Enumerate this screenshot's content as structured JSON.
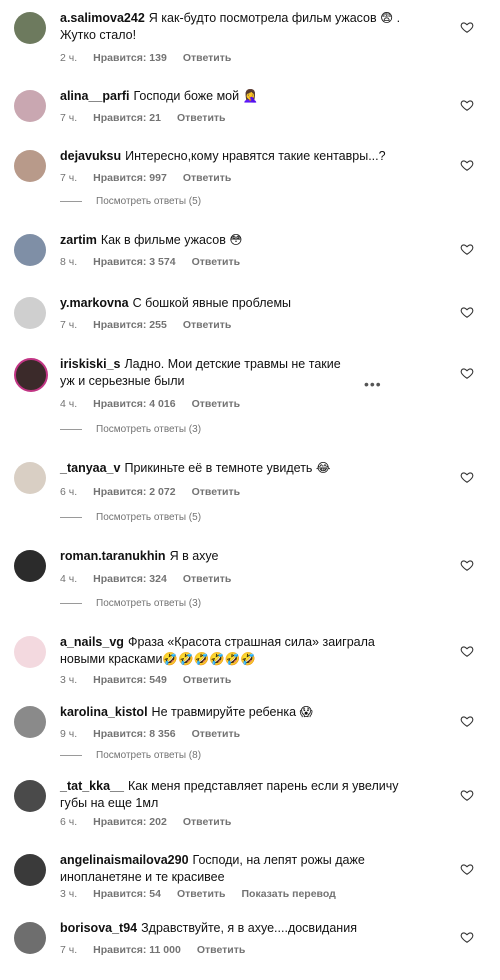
{
  "comments": [
    {
      "user": "a.salimova242",
      "text": "Я как-будто посмотрела фильм ужасов 😨 . Жутко стало!",
      "time": "2 ч.",
      "likes": "Нравится: 139",
      "reply": "Ответить",
      "avatar_color": "#6d7a5e"
    },
    {
      "user": "alina__parfi",
      "text": "Господи боже мой 🤦‍♀️",
      "time": "7 ч.",
      "likes": "Нравится: 21",
      "reply": "Ответить",
      "avatar_color": "#c9a7b1"
    },
    {
      "user": "dejavuksu",
      "text": "Интересно,кому нравятся такие кентавры...?",
      "time": "7 ч.",
      "likes": "Нравится: 997",
      "reply": "Ответить",
      "replies": "Посмотреть ответы (5)",
      "avatar_color": "#b89a8a"
    },
    {
      "user": "zartim",
      "text": "Как в фильме ужасов 😳",
      "time": "8 ч.",
      "likes": "Нравится: 3 574",
      "reply": "Ответить",
      "avatar_color": "#7f8fa6"
    },
    {
      "user": "y.markovna",
      "text": "С бошкой явные проблемы",
      "time": "7 ч.",
      "likes": "Нравится: 255",
      "reply": "Ответить",
      "avatar_color": "#cfcfcf"
    },
    {
      "user": "iriskiski_s",
      "text": "Ладно. Мои детские травмы не такие уж и серьезные были",
      "time": "4 ч.",
      "likes": "Нравится: 4 016",
      "reply": "Ответить",
      "replies": "Посмотреть ответы (3)",
      "avatar_color": "#3b2a2a"
    },
    {
      "user": "_tanyaa_v",
      "text": "Прикиньте её в темноте увидеть 😂",
      "time": "6 ч.",
      "likes": "Нравится: 2 072",
      "reply": "Ответить",
      "replies": "Посмотреть ответы (5)",
      "avatar_color": "#d9cfc4"
    },
    {
      "user": "roman.taranukhin",
      "text": "Я в ахуе",
      "time": "4 ч.",
      "likes": "Нравится: 324",
      "reply": "Ответить",
      "replies": "Посмотреть ответы (3)",
      "avatar_color": "#2b2b2b"
    },
    {
      "user": "a_nails_vg",
      "text": "Фраза «Красота страшная сила» заиграла новыми красками🤣🤣🤣🤣🤣🤣",
      "time": "3 ч.",
      "likes": "Нравится: 549",
      "reply": "Ответить",
      "avatar_color": "#f3d9df"
    },
    {
      "user": "karolina_kistol",
      "text": "Не травмируйте ребенка 😱",
      "time": "9 ч.",
      "likes": "Нравится: 8 356",
      "reply": "Ответить",
      "replies": "Посмотреть ответы (8)",
      "avatar_color": "#8a8a8a"
    },
    {
      "user": "_tat_kka__",
      "text": "Как меня представляет парень если я увеличу губы на еще 1мл",
      "time": "6 ч.",
      "likes": "Нравится: 202",
      "reply": "Ответить",
      "avatar_color": "#4a4a4a"
    },
    {
      "user": "angelinaismailova290",
      "text": "Господи, на лепят рожы даже инопланетяне и те красивее",
      "time": "3 ч.",
      "likes": "Нравится: 54",
      "reply": "Ответить",
      "translate": "Показать перевод",
      "avatar_color": "#3a3a3a"
    },
    {
      "user": "borisova_t94",
      "text": "Здравствуйте, я в ахуе....досвидания",
      "time": "7 ч.",
      "likes": "Нравится: 11 000",
      "reply": "Ответить",
      "avatar_color": "#6e6e6e"
    }
  ],
  "icons": {
    "like": "heart-outline-icon",
    "more": "more-dots-icon"
  },
  "more_dots": "•••"
}
